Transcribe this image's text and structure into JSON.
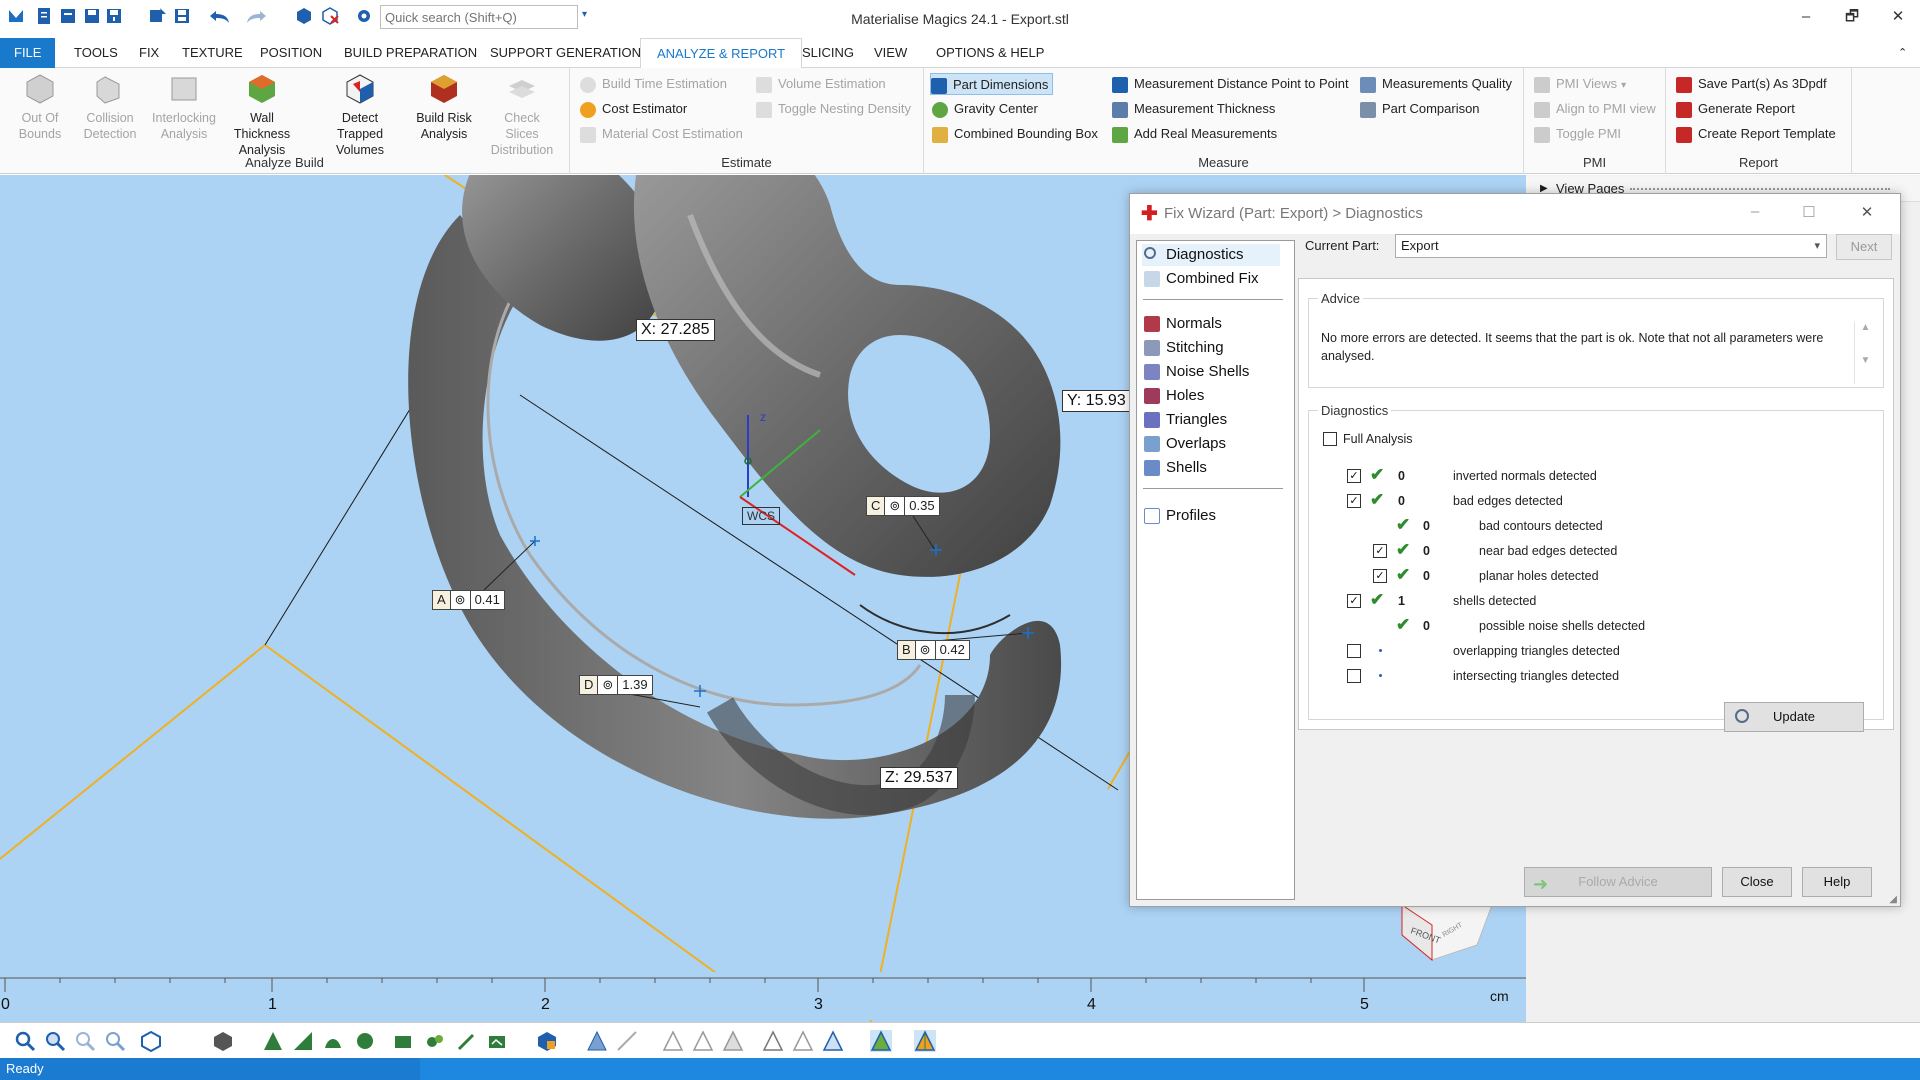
{
  "titlebar": {
    "title": "Materialise Magics 24.1 - Export.stl",
    "search_placeholder": "Quick search (Shift+Q)",
    "minimize": "–",
    "restore": "🗗",
    "close": "✕"
  },
  "menu": {
    "tabs": [
      "FILE",
      "TOOLS",
      "FIX",
      "TEXTURE",
      "POSITION",
      "BUILD PREPARATION",
      "SUPPORT GENERATION",
      "ANALYZE & REPORT",
      "SLICING",
      "VIEW",
      "OPTIONS & HELP"
    ],
    "active": "ANALYZE & REPORT",
    "collapse": "⌃"
  },
  "ribbon": {
    "analyze_build": {
      "label": "Analyze Build",
      "buttons": [
        "Out Of Bounds",
        "Collision Detection",
        "Interlocking Analysis",
        "Wall Thickness Analysis",
        "Detect Trapped Volumes",
        "Build Risk Analysis",
        "Check Slices Distribution"
      ]
    },
    "estimate": {
      "label": "Estimate",
      "build_time": "Build Time Estimation",
      "cost_estimator": "Cost Estimator",
      "material_cost": "Material Cost Estimation",
      "volume": "Volume Estimation",
      "toggle_nesting": "Toggle Nesting Density"
    },
    "measure": {
      "label": "Measure",
      "part_dimensions": "Part Dimensions",
      "gravity_center": "Gravity Center",
      "combined_bbox": "Combined Bounding Box",
      "distance_point": "Measurement Distance Point to Point",
      "thickness": "Measurement Thickness",
      "add_real": "Add Real Measurements",
      "quality": "Measurements Quality",
      "part_comparison": "Part Comparison"
    },
    "pmi": {
      "label": "PMI",
      "views": "PMI Views",
      "align": "Align to PMI view",
      "toggle": "Toggle PMI"
    },
    "report": {
      "label": "Report",
      "save_3dpdf": "Save Part(s) As 3Dpdf",
      "generate": "Generate Report",
      "template": "Create Report Template"
    }
  },
  "viewport": {
    "dim_x": "X: 27.285",
    "dim_y": "Y: 15.93",
    "dim_z": "Z: 29.537",
    "wcs": "WCS",
    "axis_z": "z",
    "pmi": [
      {
        "id": "A",
        "value": "0.41"
      },
      {
        "id": "B",
        "value": "0.42"
      },
      {
        "id": "C",
        "value": "0.35"
      },
      {
        "id": "D",
        "value": "1.39"
      }
    ],
    "ruler": {
      "ticks": [
        "0",
        "1",
        "2",
        "3",
        "4",
        "5"
      ],
      "unit": "cm"
    },
    "view_cube_label": "FRONT",
    "view_cube_label2": "RIGHT",
    "side_panel_title": "View Pages"
  },
  "dialog": {
    "title": "Fix Wizard (Part: Export) > Diagnostics",
    "nav": [
      "Diagnostics",
      "Combined Fix",
      "Normals",
      "Stitching",
      "Noise Shells",
      "Holes",
      "Triangles",
      "Overlaps",
      "Shells",
      "Profiles"
    ],
    "current_part_label": "Current Part:",
    "current_part": "Export",
    "next": "Next",
    "advice_label": "Advice",
    "advice_text": "No more errors are detected. It seems that the part is ok. Note that not all parameters were analysed.",
    "diagnostics_label": "Diagnostics",
    "full_analysis": "Full Analysis",
    "rows": [
      {
        "checked": true,
        "ok": true,
        "count": "0",
        "label": "inverted normals detected",
        "indent": 0
      },
      {
        "checked": true,
        "ok": true,
        "count": "0",
        "label": "bad edges detected",
        "indent": 0
      },
      {
        "checked": null,
        "ok": true,
        "count": "0",
        "label": "bad contours detected",
        "indent": 1
      },
      {
        "checked": true,
        "ok": true,
        "count": "0",
        "label": "near bad edges detected",
        "indent": 1
      },
      {
        "checked": true,
        "ok": true,
        "count": "0",
        "label": "planar holes detected",
        "indent": 1
      },
      {
        "checked": true,
        "ok": true,
        "count": "1",
        "label": "shells detected",
        "indent": 0
      },
      {
        "checked": null,
        "ok": true,
        "count": "0",
        "label": "possible noise shells detected",
        "indent": 1
      },
      {
        "checked": false,
        "ok": false,
        "count": "",
        "label": "overlapping triangles detected",
        "indent": 0
      },
      {
        "checked": false,
        "ok": false,
        "count": "",
        "label": "intersecting triangles detected",
        "indent": 0
      }
    ],
    "update": "Update",
    "follow_advice": "Follow Advice",
    "close": "Close",
    "help": "Help"
  },
  "status": {
    "text": "Ready"
  }
}
